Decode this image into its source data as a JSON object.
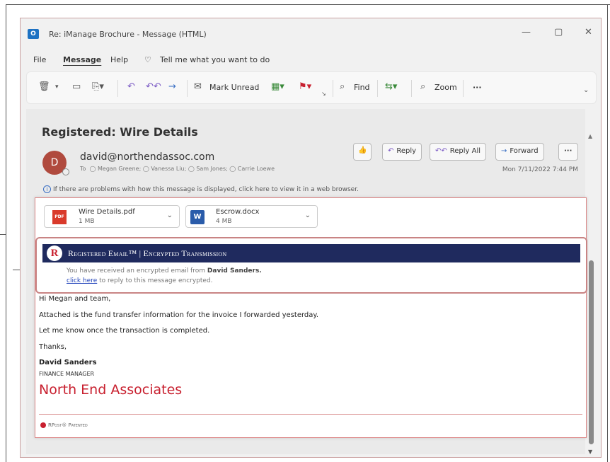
{
  "window": {
    "title": "Re: iManage Brochure  -  Message (HTML)",
    "app_icon": "outlook-icon",
    "minimize": "—",
    "maximize": "▢",
    "close": "✕"
  },
  "menu": {
    "file": "File",
    "message": "Message",
    "help": "Help",
    "tell_me": "Tell me what you want to do"
  },
  "toolbar": {
    "mark_unread": "Mark Unread",
    "find": "Find",
    "zoom": "Zoom",
    "more": "···"
  },
  "message": {
    "subject": "Registered: Wire Details",
    "avatar_letter": "D",
    "sender": "david@northendassoc.com",
    "to_label": "To",
    "recipients": "◯ Megan Greene;  ◯ Vanessa Liu;  ◯ Sam Jones;  ◯ Carrie Loewe",
    "date": "Mon 7/11/2022 7:44 PM",
    "info": "If there are problems with how this message is displayed, click here to view it in a web browser.",
    "actions": {
      "reply": "Reply",
      "reply_all": "Reply All",
      "forward": "Forward",
      "more": "···"
    }
  },
  "attachments": [
    {
      "name": "Wire Details.pdf",
      "size": "1 MB",
      "type_badge": "PDF"
    },
    {
      "name": "Escrow.docx",
      "size": "4 MB",
      "type_badge": "W"
    }
  ],
  "registered": {
    "logo": "R",
    "title": "Registered Email™ | Encrypted Transmission",
    "line1_prefix": "You have received an encrypted email from ",
    "line1_name": "David Sanders.",
    "click_here": "click here",
    "line2_suffix": " to reply to this message encrypted."
  },
  "body": {
    "greeting": "Hi Megan and team,",
    "line1": "Attached is the fund transfer information for the invoice I forwarded yesterday.",
    "line2": "Let me know once the transaction is completed.",
    "closing": "Thanks,",
    "sig_name": "David Sanders",
    "sig_title": "FINANCE MANAGER",
    "company": "North End Associates"
  },
  "footer": {
    "mark": "RPost® Patented"
  },
  "colors": {
    "brand_red": "#c8202f",
    "header_navy": "#1f2a5e",
    "accent_purple": "#7a59c4"
  }
}
